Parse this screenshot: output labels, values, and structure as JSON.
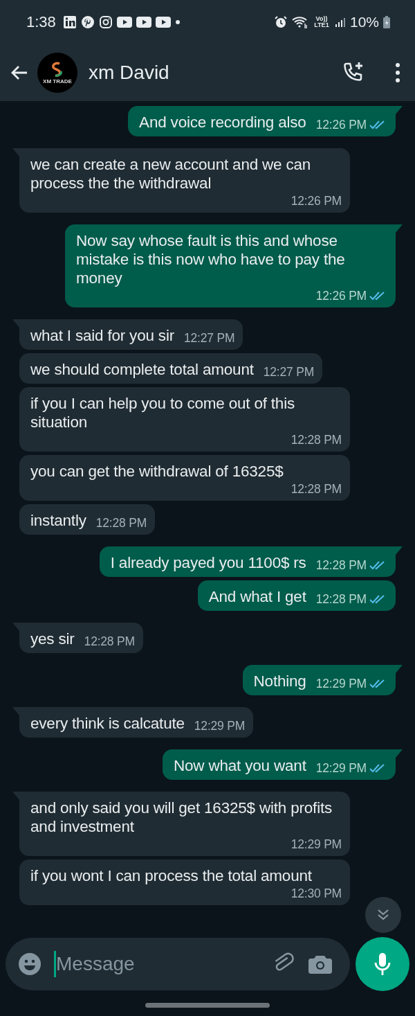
{
  "status_bar": {
    "time": "1:38",
    "battery": "10%",
    "network": "Vo)) LTE1"
  },
  "header": {
    "contact_name": "xm David",
    "avatar_text": "XM TRADE"
  },
  "messages": [
    {
      "kind": "sent",
      "text": "And voice recording also",
      "time": "12:26 PM",
      "read": true
    },
    {
      "kind": "received",
      "text": "we can create a new account and we can process the the withdrawal",
      "time": "12:26 PM"
    },
    {
      "kind": "sent",
      "text": "Now say whose fault is this and whose mistake is this now who have to pay the money",
      "time": "12:26 PM",
      "read": true
    },
    {
      "kind": "received",
      "text": "what I said for you sir",
      "time": "12:27 PM"
    },
    {
      "kind": "received",
      "text": "we should complete total amount",
      "time": "12:27 PM"
    },
    {
      "kind": "received",
      "text": "if you I can help you to come out of this situation",
      "time": "12:28 PM"
    },
    {
      "kind": "received",
      "text": "you can get the withdrawal of 16325$",
      "time": "12:28 PM"
    },
    {
      "kind": "received",
      "text": "instantly",
      "time": "12:28 PM"
    },
    {
      "kind": "sent",
      "text": "I already payed you 1100$ rs",
      "time": "12:28 PM",
      "read": true
    },
    {
      "kind": "sent",
      "text": "And what I get",
      "time": "12:28 PM",
      "read": true
    },
    {
      "kind": "received",
      "text": "yes sir",
      "time": "12:28 PM"
    },
    {
      "kind": "sent",
      "text": "Nothing",
      "time": "12:29 PM",
      "read": true
    },
    {
      "kind": "received",
      "text": "every think is calcatute",
      "time": "12:29 PM"
    },
    {
      "kind": "sent",
      "text": "Now what you want",
      "time": "12:29 PM",
      "read": true
    },
    {
      "kind": "received",
      "text": "and only said you will get 16325$ with profits and investment",
      "time": "12:29 PM"
    },
    {
      "kind": "received",
      "text": "if you wont I can process the total amount",
      "time": "12:30 PM"
    }
  ],
  "composer": {
    "placeholder": "Message"
  }
}
